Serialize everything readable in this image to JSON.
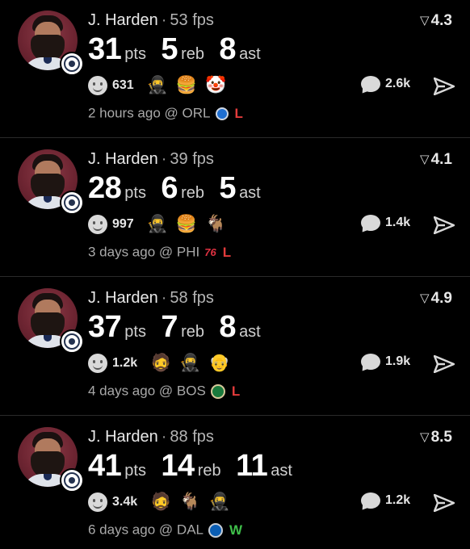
{
  "feed": [
    {
      "player": "J. Harden",
      "fps": "53 fps",
      "score": "4.3",
      "pts": "31",
      "reb": "5",
      "ast": "8",
      "pts_label": "pts",
      "reb_label": "reb",
      "ast_label": "ast",
      "reactions": "631",
      "emojis": [
        "🥷",
        "🍔",
        "🤡"
      ],
      "comments": "2.6k",
      "time": "2 hours ago",
      "opponent": "ORL",
      "logo": "magic-logo-icon",
      "logo_text": "",
      "result": "L"
    },
    {
      "player": "J. Harden",
      "fps": "39 fps",
      "score": "4.1",
      "pts": "28",
      "reb": "6",
      "ast": "5",
      "pts_label": "pts",
      "reb_label": "reb",
      "ast_label": "ast",
      "reactions": "997",
      "emojis": [
        "🥷",
        "🍔",
        "🐐"
      ],
      "comments": "1.4k",
      "time": "3 days ago",
      "opponent": "PHI",
      "logo": "sixers-logo-icon",
      "logo_text": "76",
      "result": "L"
    },
    {
      "player": "J. Harden",
      "fps": "58 fps",
      "score": "4.9",
      "pts": "37",
      "reb": "7",
      "ast": "8",
      "pts_label": "pts",
      "reb_label": "reb",
      "ast_label": "ast",
      "reactions": "1.2k",
      "emojis": [
        "🧔",
        "🥷",
        "👴"
      ],
      "comments": "1.9k",
      "time": "4 days ago",
      "opponent": "BOS",
      "logo": "celtics-logo-icon",
      "logo_text": "",
      "result": "L"
    },
    {
      "player": "J. Harden",
      "fps": "88 fps",
      "score": "8.5",
      "pts": "41",
      "reb": "14",
      "ast": "11",
      "pts_label": "pts",
      "reb_label": "reb",
      "ast_label": "ast",
      "reactions": "3.4k",
      "emojis": [
        "🧔",
        "🐐",
        "🥷"
      ],
      "comments": "1.2k",
      "time": "6 days ago",
      "opponent": "DAL",
      "logo": "mavericks-logo-icon",
      "logo_text": "",
      "result": "W"
    }
  ],
  "at_symbol": "@",
  "separator": "·",
  "colors": {
    "loss": "#e23b3b",
    "win": "#3fbf4a",
    "background": "#000000"
  }
}
